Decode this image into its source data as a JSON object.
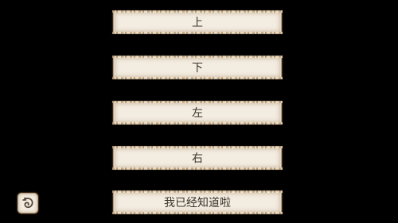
{
  "menu": {
    "up_label": "上",
    "down_label": "下",
    "left_label": "左",
    "right_label": "右",
    "confirm_label": "我已经知道啦"
  },
  "icons": {
    "back": "back-swirl-icon"
  },
  "colors": {
    "background": "#000000",
    "button_fill": "#f3ece0",
    "button_border": "#b99d78",
    "text": "#3a332c"
  }
}
